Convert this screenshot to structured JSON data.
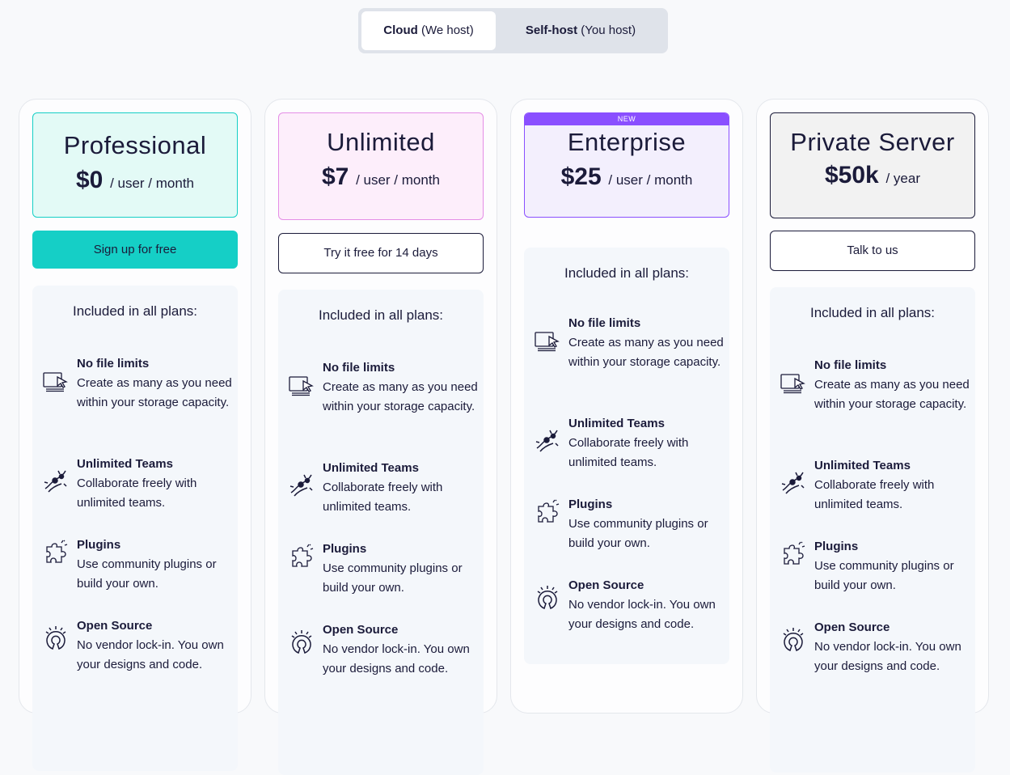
{
  "toggle": {
    "cloud_bold": "Cloud",
    "cloud_rest": " (We host)",
    "self_bold": "Self-host",
    "self_rest": " (You host)"
  },
  "colors": {
    "teal": "#15cfc6",
    "purple": "#8a4fff",
    "navy": "#1b1b3a"
  },
  "features_title": "Included in all plans:",
  "features": [
    {
      "icon": "file-icon",
      "title": "No file limits",
      "desc": "Create as many as you need within your storage capacity."
    },
    {
      "icon": "teams-icon",
      "title": "Unlimited Teams",
      "desc": "Collaborate freely with unlimited teams."
    },
    {
      "icon": "puzzle-icon",
      "title": "Plugins",
      "desc": "Use community plugins or build your own."
    },
    {
      "icon": "open-source-icon",
      "title": "Open Source",
      "desc": "No vendor lock-in. You own your designs and code."
    }
  ],
  "plans": [
    {
      "name": "Professional",
      "price": "$0",
      "period": " / user / month",
      "cta": "Sign up for free"
    },
    {
      "name": "Unlimited",
      "price": "$7",
      "period": " / user / month",
      "cta": "Try it free for 14 days"
    },
    {
      "name": "Enterprise",
      "badge": "NEW",
      "price": "$25",
      "period": " / user / month",
      "cta": ""
    },
    {
      "name": "Private Server",
      "price": "$50k",
      "period": " / year",
      "cta": "Talk to us"
    }
  ]
}
